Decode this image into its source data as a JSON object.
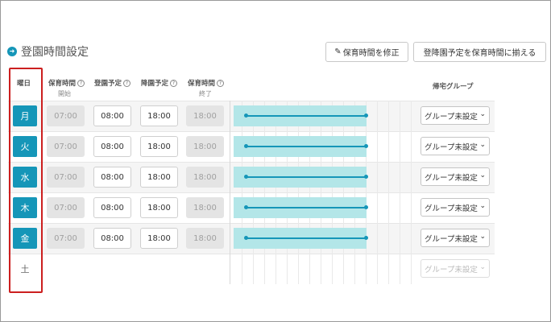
{
  "section": {
    "title": "登園時間設定",
    "icon": "arrow-circle-icon"
  },
  "buttons": {
    "edit_label": "保育時間を修正",
    "edit_icon": "pencil-icon",
    "match_label": "登降園予定を保育時間に揃える"
  },
  "headers": {
    "weekday": "曜日",
    "care_start": "保育時間",
    "care_start_sub": "開始",
    "arrival": "登園予定",
    "departure": "降園予定",
    "care_end": "保育時間",
    "care_end_sub": "終了",
    "group": "帰宅グループ",
    "help_glyph": "?"
  },
  "rows": [
    {
      "day": "月",
      "care_start": "07:00",
      "arrival": "08:00",
      "departure": "18:00",
      "care_end": "18:00",
      "group": "グループ未設定",
      "enabled": true
    },
    {
      "day": "火",
      "care_start": "07:00",
      "arrival": "08:00",
      "departure": "18:00",
      "care_end": "18:00",
      "group": "グループ未設定",
      "enabled": true
    },
    {
      "day": "水",
      "care_start": "07:00",
      "arrival": "08:00",
      "departure": "18:00",
      "care_end": "18:00",
      "group": "グループ未設定",
      "enabled": true
    },
    {
      "day": "木",
      "care_start": "07:00",
      "arrival": "08:00",
      "departure": "18:00",
      "care_end": "18:00",
      "group": "グループ未設定",
      "enabled": true
    },
    {
      "day": "金",
      "care_start": "07:00",
      "arrival": "08:00",
      "departure": "18:00",
      "care_end": "18:00",
      "group": "グループ未設定",
      "enabled": true
    },
    {
      "day": "土",
      "group": "グループ未設定",
      "enabled": false
    }
  ],
  "colors": {
    "accent": "#1596b8",
    "bar": "#b3e6e8",
    "highlight": "#cc1f1f"
  }
}
